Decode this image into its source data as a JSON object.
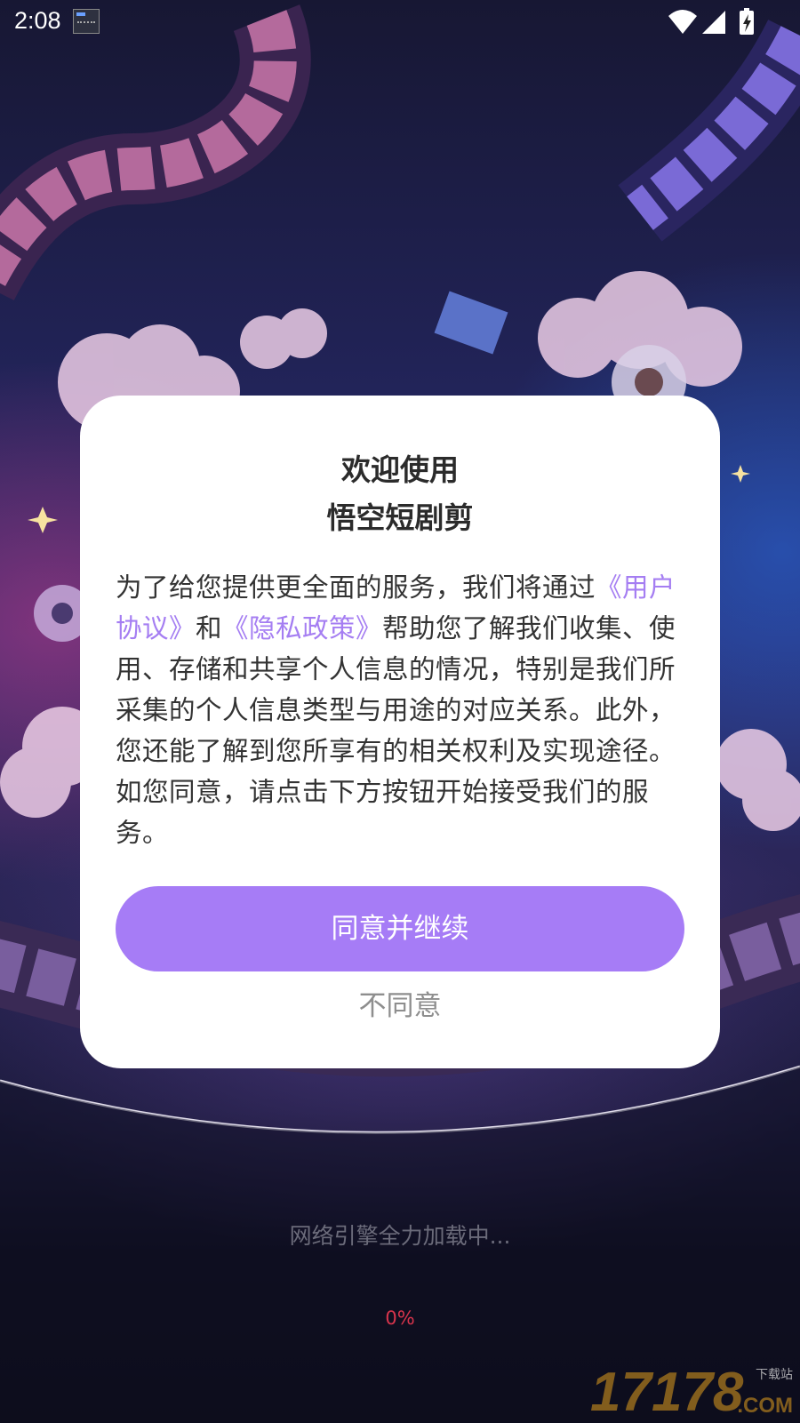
{
  "status_bar": {
    "time": "2:08",
    "icons": [
      "notification-icon",
      "wifi-icon",
      "signal-icon",
      "battery-charging-icon"
    ]
  },
  "dialog": {
    "title_line1": "欢迎使用",
    "title_line2": "悟空短剧剪",
    "body": {
      "part1": "为了给您提供更全面的服务，我们将通过",
      "user_agreement_link": "《用户协议》",
      "connector": "和",
      "privacy_policy_link": "《隐私政策》",
      "part2": "帮助您了解我们收集、使用、存储和共享个人信息的情况，特别是我们所采集的个人信息类型与用途的对应关系。此外，您还能了解到您所享有的相关权利及实现途径。如您同意，请点击下方按钮开始接受我们的服务。"
    },
    "agree_label": "同意并继续",
    "disagree_label": "不同意"
  },
  "loading": {
    "text": "网络引擎全力加载中...",
    "progress": "0%"
  },
  "watermark": {
    "number": "17178",
    "small": "下载站",
    "domain": ".COM"
  },
  "colors": {
    "accent": "#a67cf6",
    "link": "#a57ef2",
    "progress": "#d8344c"
  }
}
